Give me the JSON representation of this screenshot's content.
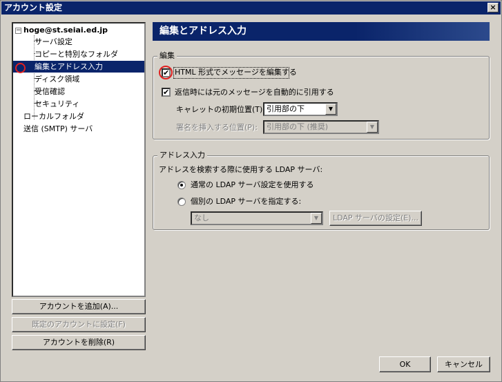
{
  "window": {
    "title": "アカウント設定",
    "close_glyph": "×"
  },
  "tree": {
    "expander": "−",
    "account": "hoge@st.seiai.ed.jp",
    "items": [
      {
        "label": "サーバ設定"
      },
      {
        "label": "コピーと特別なフォルダ"
      },
      {
        "label": "編集とアドレス入力"
      },
      {
        "label": "ディスク領域"
      },
      {
        "label": "受信確認"
      },
      {
        "label": "セキュリティ"
      }
    ],
    "local_folder": "ローカルフォルダ",
    "smtp": "送信 (SMTP) サーバ"
  },
  "left_buttons": {
    "add": "アカウントを追加(A)...",
    "set_default": "既定のアカウントに設定(F)",
    "delete": "アカウントを削除(R)"
  },
  "panel": {
    "title": "編集とアドレス入力",
    "editing": {
      "group_title": "編集",
      "html_compose": "HTML 形式でメッセージを編集する",
      "html_compose_checked": true,
      "auto_quote": "返信時には元のメッセージを自動的に引用する",
      "auto_quote_checked": true,
      "caret_label": "キャレットの初期位置(T):",
      "caret_value": "引用部の下",
      "signature_label": "署名を挿入する位置(P):",
      "signature_value": "引用部の下 (推奨)"
    },
    "addressing": {
      "group_title": "アドレス入力",
      "ldap_label": "アドレスを検索する際に使用する LDAP サーバ:",
      "use_global": "通常の LDAP サーバ設定を使用する",
      "use_custom": "個別の LDAP サーバを指定する:",
      "selected": "use_global",
      "directory_value": "なし",
      "edit_directories": "LDAP サーバの設定(E)..."
    }
  },
  "footer": {
    "ok": "OK",
    "cancel": "キャンセル"
  },
  "glyphs": {
    "check": "✔",
    "dropdown": "▼"
  },
  "colors": {
    "titlebar": "#0a246a",
    "selection": "#0a246a",
    "face": "#d4d0c8",
    "annotation": "#e02020"
  }
}
